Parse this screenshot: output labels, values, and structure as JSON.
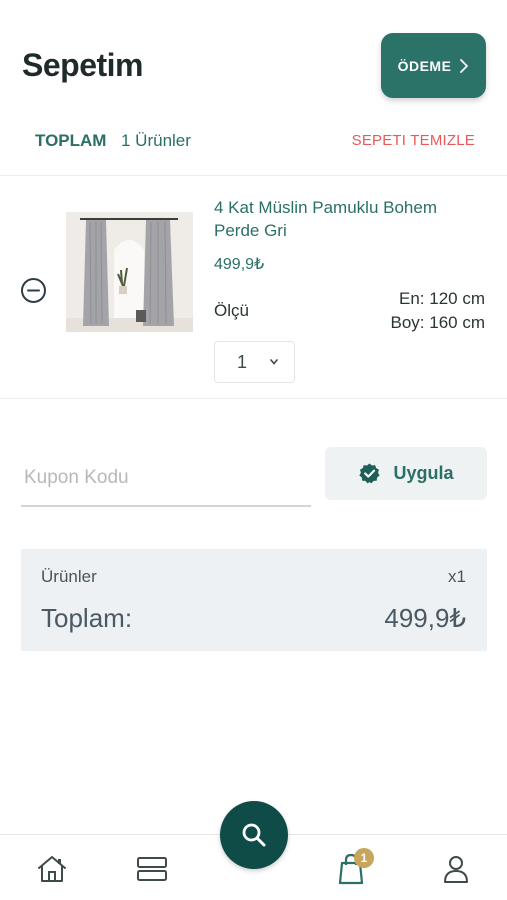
{
  "header": {
    "title": "Sepetim",
    "checkout_label": "ÖDEME"
  },
  "summary": {
    "total_label": "TOPLAM",
    "item_count": "1 Ürünler",
    "clear_label": "SEPETI TEMIZLE"
  },
  "cart_items": [
    {
      "name": "4 Kat Müslin Pamuklu Bohem Perde Gri",
      "price": "499,9₺",
      "size_label": "Ölçü",
      "width": "En: 120 cm",
      "height": "Boy: 160 cm",
      "quantity": "1"
    }
  ],
  "coupon": {
    "placeholder": "Kupon Kodu",
    "value": "",
    "apply_label": "Uygula"
  },
  "totals": {
    "products_label": "Ürünler",
    "products_qty": "x1",
    "grand_label": "Toplam:",
    "grand_value": "499,9₺"
  },
  "nav": {
    "cart_badge": "1",
    "items": [
      "home-icon",
      "categories-icon",
      "search-icon",
      "cart-icon",
      "account-icon"
    ]
  },
  "colors": {
    "brand": "#2b7268",
    "brand_dark": "#0f4c47",
    "danger": "#e85a5a",
    "badge": "#c9a45c"
  }
}
